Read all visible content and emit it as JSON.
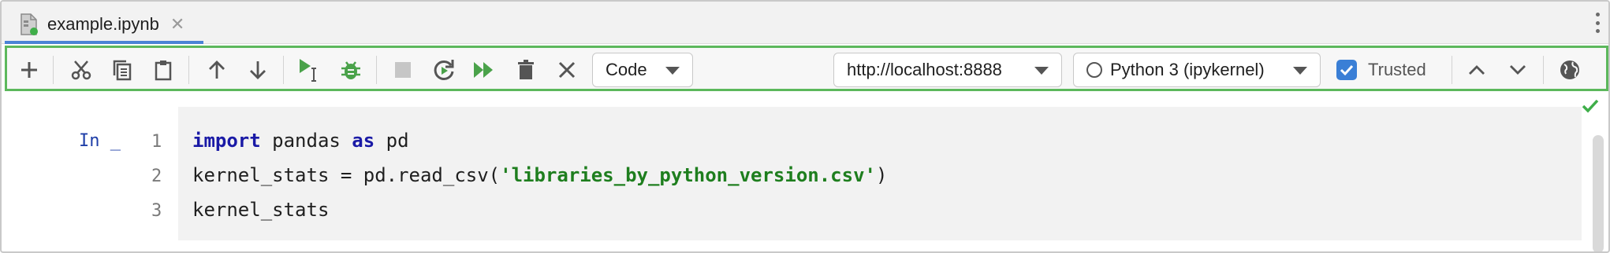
{
  "tab": {
    "title": "example.ipynb",
    "close_glyph": "✕"
  },
  "toolbar": {
    "buttons": [
      {
        "name": "add-cell-button",
        "icon": "plus-icon"
      },
      {
        "name": "cut-button",
        "icon": "scissors-icon"
      },
      {
        "name": "copy-button",
        "icon": "copy-icon"
      },
      {
        "name": "paste-button",
        "icon": "clipboard-icon"
      },
      {
        "name": "move-up-button",
        "icon": "arrow-up-icon"
      },
      {
        "name": "move-down-button",
        "icon": "arrow-down-icon"
      },
      {
        "name": "run-cell-button",
        "icon": "run-cursor-icon"
      },
      {
        "name": "debug-button",
        "icon": "bug-icon"
      },
      {
        "name": "stop-button",
        "icon": "stop-icon"
      },
      {
        "name": "restart-button",
        "icon": "restart-icon"
      },
      {
        "name": "run-all-button",
        "icon": "fast-forward-icon"
      },
      {
        "name": "delete-button",
        "icon": "trash-icon"
      },
      {
        "name": "clear-button",
        "icon": "close-icon"
      }
    ],
    "cell_type": "Code",
    "server_url": "http://localhost:8888",
    "kernel": "Python 3 (ipykernel)",
    "trusted_label": "Trusted",
    "trusted_checked": true,
    "accent_color": "#5cb85c"
  },
  "cell": {
    "prompt": "In _",
    "line_numbers": [
      "1",
      "2",
      "3"
    ],
    "lines": [
      [
        {
          "t": "import",
          "c": "kw"
        },
        {
          "t": " pandas ",
          "c": ""
        },
        {
          "t": "as",
          "c": "kw"
        },
        {
          "t": " pd",
          "c": ""
        }
      ],
      [
        {
          "t": "kernel_stats = pd.read_csv(",
          "c": ""
        },
        {
          "t": "'libraries_by_python_version.csv'",
          "c": "str"
        },
        {
          "t": ")",
          "c": ""
        }
      ],
      [
        {
          "t": "kernel_stats",
          "c": ""
        }
      ]
    ]
  }
}
